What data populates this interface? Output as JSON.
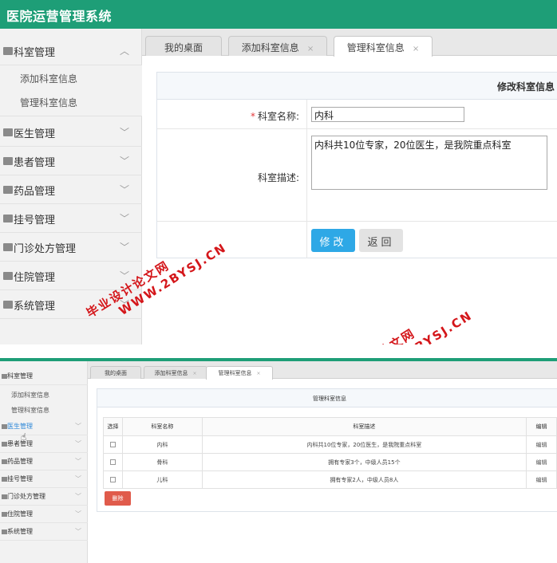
{
  "app": {
    "title": "医院运营管理系统"
  },
  "sidebar": {
    "groups": [
      {
        "label": "科室管理",
        "chevron": "︿"
      },
      {
        "label": "医生管理",
        "chevron": "﹀"
      },
      {
        "label": "患者管理",
        "chevron": "﹀"
      },
      {
        "label": "药品管理",
        "chevron": "﹀"
      },
      {
        "label": "挂号管理",
        "chevron": "﹀"
      },
      {
        "label": "门诊处方管理",
        "chevron": "﹀"
      },
      {
        "label": "住院管理",
        "chevron": "﹀"
      },
      {
        "label": "系统管理",
        "chevron": "﹀"
      }
    ],
    "sub_items": [
      "添加科室信息",
      "管理科室信息"
    ]
  },
  "tabs": [
    {
      "label": "我的桌面",
      "close": ""
    },
    {
      "label": "添加科室信息",
      "close": "×"
    },
    {
      "label": "管理科室信息",
      "close": "×"
    }
  ],
  "edit_form": {
    "header": "修改科室信息",
    "required_mark": "*",
    "name_label": "科室名称:",
    "name_value": "内科",
    "desc_label": "科室描述:",
    "desc_value": "内科共10位专家，20位医生，是我院重点科室",
    "submit_label": "修改",
    "back_label": "返回"
  },
  "list_panel": {
    "header": "管理科室信息",
    "columns": [
      "选择",
      "科室名称",
      "科室描述",
      "编辑"
    ],
    "rows": [
      {
        "name": "内科",
        "desc": "内科共10位专家，20位医生，是我院重点科室",
        "edit": "编辑"
      },
      {
        "name": "骨科",
        "desc": "拥有专家3个，中级人员15个",
        "edit": "编辑"
      },
      {
        "name": "儿科",
        "desc": "拥有专家2人，中级人员8人",
        "edit": "编辑"
      }
    ],
    "delete_label": "删除"
  },
  "watermarks": [
    {
      "line1": "毕业设计论文网",
      "line2": "WWW.2BYSJ.CN"
    }
  ],
  "colors": {
    "header_green": "#1e9e77",
    "primary_blue": "#2ea8e6",
    "danger_red": "#e05b4b",
    "watermark_red": "#d4161a"
  },
  "icons": {
    "group": "folder-icon",
    "expand": "chevron-down-icon",
    "collapse": "chevron-up-icon",
    "close": "close-icon",
    "cursor": "hand-pointer-icon"
  }
}
